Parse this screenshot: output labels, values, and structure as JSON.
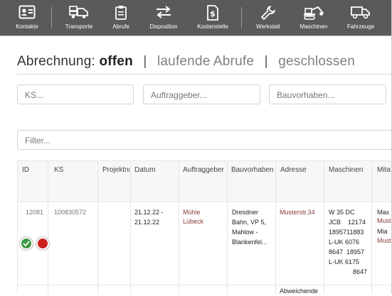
{
  "toolbar": {
    "items": [
      {
        "label": "Kontakte",
        "icon": "contact-card-icon"
      },
      {
        "label": "Transporte",
        "icon": "truck-icon"
      },
      {
        "label": "Abrufe",
        "icon": "clipboard-icon"
      },
      {
        "label": "Disposition",
        "icon": "swap-arrows-icon"
      },
      {
        "label": "Kostenstelle",
        "icon": "dollar-document-icon"
      },
      {
        "label": "Werkstatt",
        "icon": "wrench-icon"
      },
      {
        "label": "Maschinen",
        "icon": "excavator-icon"
      },
      {
        "label": "Fahrzeuge",
        "icon": "vehicle-icon"
      }
    ]
  },
  "heading": {
    "label": "Abrechnung:",
    "tab_open": "offen",
    "separator": "|",
    "tab_running": "laufende Abrufe",
    "tab_closed": "geschlossen"
  },
  "filters": {
    "ks_placeholder": "KS...",
    "auftraggeber_placeholder": "Auftraggeber...",
    "bauvorhaben_placeholder": "Bauvorhaben...",
    "filter_placeholder": "Filter..."
  },
  "table": {
    "columns": [
      "ID",
      "KS",
      "Projektnr",
      "Datum",
      "Auftraggeber",
      "Bauvorhaben",
      "Adresse",
      "Maschinen",
      "Mita"
    ],
    "rows": [
      {
        "id": "12081",
        "ks": "100830572",
        "projektnr": "",
        "datum": [
          "21.12.22 -",
          "21.12.22"
        ],
        "auftraggeber": [
          "Mühle",
          "Lübeck"
        ],
        "bauvorhaben": [
          "Dresdner",
          "Bahn, VP 5,",
          "Mahlow -",
          "Blankenfel..."
        ],
        "adresse": "Musterstr.34",
        "maschinen": [
          "W 35 DC",
          "JCB    12174",
          "1895711883",
          "L-UK 6076",
          "8647  18957",
          "L-UK 6175",
          "8647"
        ],
        "mitarbeiter": [
          "Max",
          "Must",
          "Mia",
          "Must"
        ],
        "status_ok": "check-icon",
        "status_open": "red-status-icon"
      }
    ],
    "next_row_partial": "Abweichende"
  },
  "colors": {
    "toolbar": "#5a5a5a",
    "ok": "#3d9a45",
    "open": "#cc1f1f",
    "client_text": "#8a3838"
  }
}
